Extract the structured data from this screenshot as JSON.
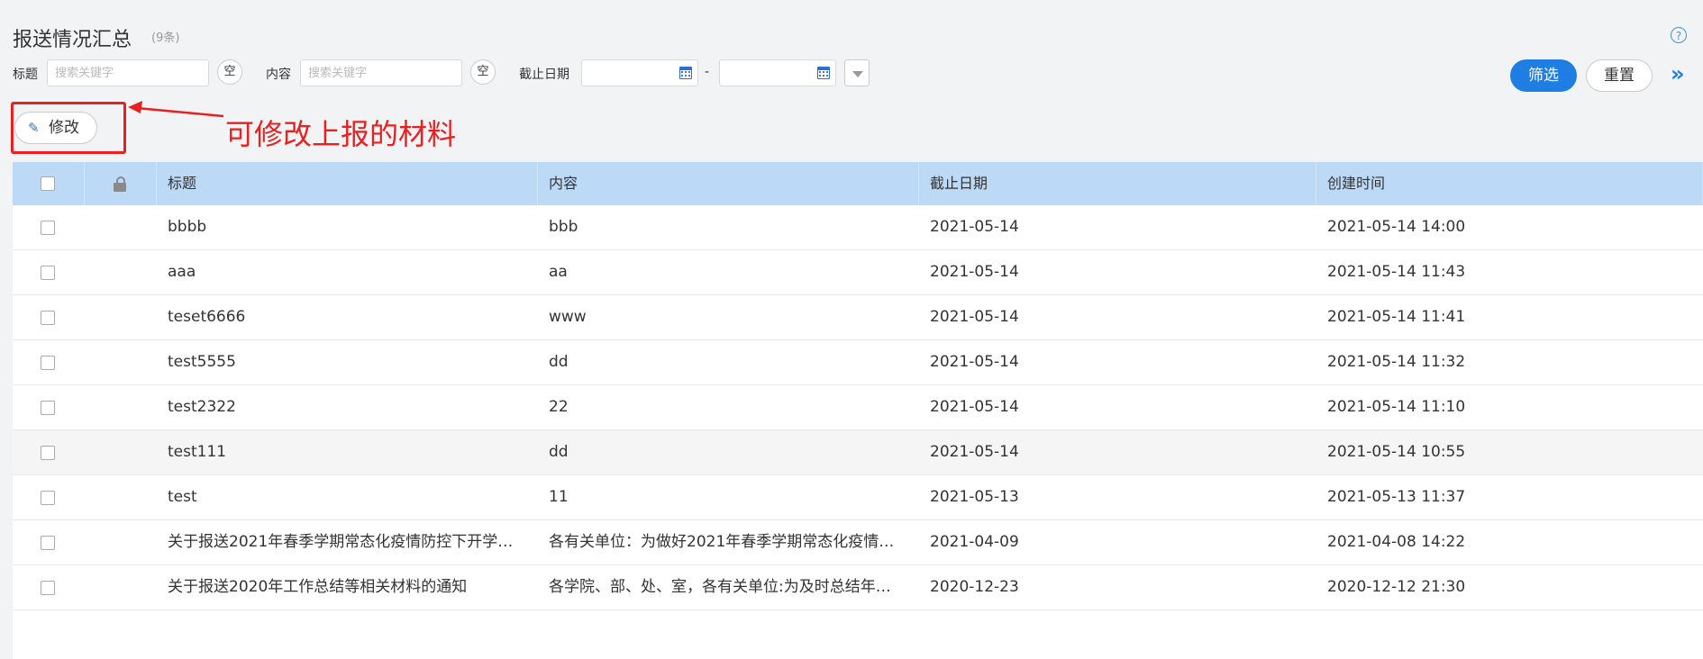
{
  "header": {
    "title": "报送情况汇总",
    "count": "(9条)",
    "help_glyph": "?"
  },
  "filters": {
    "title_label": "标题",
    "title_placeholder": "搜索关键字",
    "content_label": "内容",
    "content_placeholder": "搜索关键字",
    "empty_label": "空",
    "deadline_label": "截止日期",
    "date_separator": "-",
    "filter_button": "筛选",
    "reset_button": "重置",
    "expand_glyph": "»"
  },
  "toolbar": {
    "edit_label": "修改"
  },
  "annotation": {
    "text": "可修改上报的材料",
    "color": "#e82020"
  },
  "table": {
    "columns": [
      "标题",
      "内容",
      "截止日期",
      "创建时间"
    ],
    "rows": [
      {
        "title": "bbbb",
        "content": "bbb",
        "deadline": "2021-05-14",
        "created": "2021-05-14 14:00"
      },
      {
        "title": "aaa",
        "content": "aa",
        "deadline": "2021-05-14",
        "created": "2021-05-14 11:43"
      },
      {
        "title": "teset6666",
        "content": "www",
        "deadline": "2021-05-14",
        "created": "2021-05-14 11:41"
      },
      {
        "title": "test5555",
        "content": "dd",
        "deadline": "2021-05-14",
        "created": "2021-05-14 11:32"
      },
      {
        "title": "test2322",
        "content": "22",
        "deadline": "2021-05-14",
        "created": "2021-05-14 11:10"
      },
      {
        "title": "test111",
        "content": "dd",
        "deadline": "2021-05-14",
        "created": "2021-05-14 10:55"
      },
      {
        "title": "test",
        "content": "11",
        "deadline": "2021-05-13",
        "created": "2021-05-13 11:37"
      },
      {
        "title": "关于报送2021年春季学期常态化疫情防控下开学…",
        "content": "各有关单位：为做好2021年春季学期常态化疫情…",
        "deadline": "2021-04-09",
        "created": "2021-04-08 14:22"
      },
      {
        "title": "关于报送2020年工作总结等相关材料的通知",
        "content": "各学院、部、处、室，各有关单位:为及时总结年…",
        "deadline": "2020-12-23",
        "created": "2020-12-12 21:30"
      }
    ]
  },
  "colors": {
    "primary": "#1e7ee4",
    "header_bg": "#bcd9f6",
    "page_bg": "#f2f3f5"
  }
}
